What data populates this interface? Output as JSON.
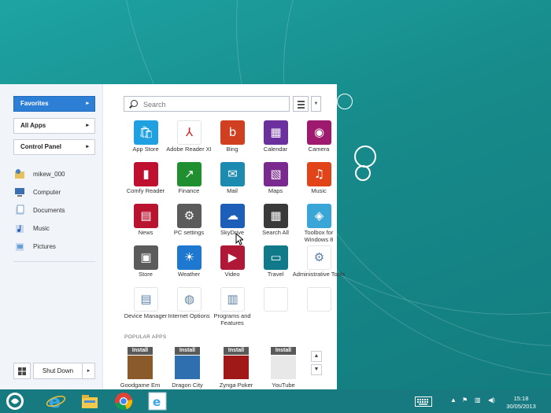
{
  "left_pane": {
    "favorites": "Favorites",
    "all_apps": "All Apps",
    "control_panel": "Control Panel",
    "places": [
      {
        "label": "mikew_000",
        "icon": "user-folder-icon"
      },
      {
        "label": "Computer",
        "icon": "computer-icon"
      },
      {
        "label": "Documents",
        "icon": "documents-icon"
      },
      {
        "label": "Music",
        "icon": "music-library-icon"
      },
      {
        "label": "Pictures",
        "icon": "pictures-icon"
      }
    ],
    "shutdown": "Shut Down"
  },
  "search": {
    "placeholder": "Search"
  },
  "tiles": [
    {
      "label": "App Store",
      "color": "#1fa0e0",
      "icon": "app-store-icon"
    },
    {
      "label": "Adobe Reader XI",
      "color": "#ffffff",
      "icon": "adobe-reader-icon"
    },
    {
      "label": "Bing",
      "color": "#d04020",
      "icon": "bing-icon"
    },
    {
      "label": "Calendar",
      "color": "#6b2f9e",
      "icon": "calendar-icon"
    },
    {
      "label": "Camera",
      "color": "#9e1a6e",
      "icon": "camera-icon"
    },
    {
      "label": "Comfy Reader",
      "color": "#c0102f",
      "icon": "comfy-reader-icon"
    },
    {
      "label": "Finance",
      "color": "#1f8f30",
      "icon": "finance-icon"
    },
    {
      "label": "Mail",
      "color": "#1d8ab0",
      "icon": "mail-icon"
    },
    {
      "label": "Maps",
      "color": "#7a2a8f",
      "icon": "maps-icon"
    },
    {
      "label": "Music",
      "color": "#e2441a",
      "icon": "music-icon"
    },
    {
      "label": "News",
      "color": "#b8132f",
      "icon": "news-icon"
    },
    {
      "label": "PC settings",
      "color": "#5b5b5b",
      "icon": "settings-gear-icon"
    },
    {
      "label": "SkyDrive",
      "color": "#1d5fb8",
      "icon": "skydrive-icon"
    },
    {
      "label": "Search All",
      "color": "#3a3a3a",
      "icon": "search-all-icon"
    },
    {
      "label": "Toolbox for Windows 8",
      "color": "#3aa6d8",
      "icon": "toolbox-icon"
    },
    {
      "label": "Store",
      "color": "#5b5b5b",
      "icon": "store-icon"
    },
    {
      "label": "Weather",
      "color": "#1e78d0",
      "icon": "weather-icon"
    },
    {
      "label": "Video",
      "color": "#b01838",
      "icon": "video-icon"
    },
    {
      "label": "Travel",
      "color": "#117a8a",
      "icon": "travel-icon"
    },
    {
      "label": "Administrative Tools",
      "color": "#ffffff",
      "icon": "administrative-tools-icon"
    },
    {
      "label": "Device Manager",
      "color": "#ffffff",
      "icon": "device-manager-icon"
    },
    {
      "label": "Internet Options",
      "color": "#ffffff",
      "icon": "internet-options-icon"
    },
    {
      "label": "Programs and Features",
      "color": "#ffffff",
      "icon": "programs-features-icon"
    },
    {
      "label": "",
      "color": "#ffffff",
      "icon": "empty-slot"
    },
    {
      "label": "",
      "color": "#ffffff",
      "icon": "empty-slot"
    }
  ],
  "popular": {
    "heading": "POPULAR APPS",
    "install_label": "Install",
    "apps": [
      {
        "label": "Goodgame Em",
        "color": "#8a5a2a"
      },
      {
        "label": "Dragon City",
        "color": "#2f6fb0"
      },
      {
        "label": "Zynga Poker",
        "color": "#a01818"
      },
      {
        "label": "YouTube",
        "color": "#e8e8e8"
      }
    ]
  },
  "taskbar": {
    "time": "15:18",
    "date": "30/05/2013"
  }
}
